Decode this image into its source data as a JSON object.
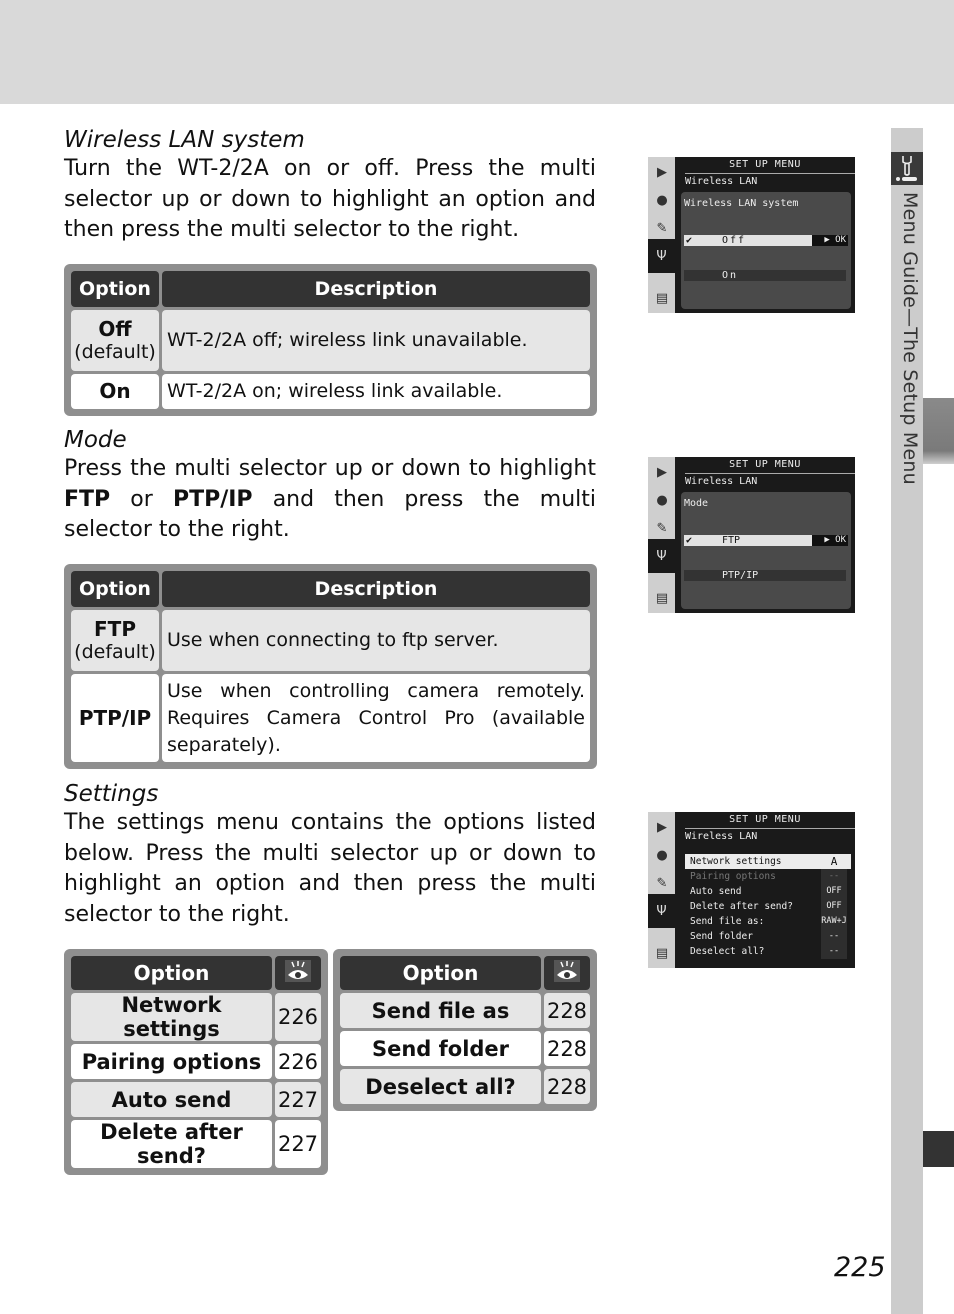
{
  "page": {
    "number": "225",
    "side_label": "Menu Guide—The Setup Menu",
    "side_icon": "wrench-icon"
  },
  "sections": {
    "wireless_lan_system": {
      "title": "Wireless LAN system",
      "body": "Turn the WT-2/2A on or off.  Press the multi selector up or down to highlight an option and then press the multi selector to the right.",
      "table": {
        "headers": [
          "Option",
          "Description"
        ],
        "rows": [
          {
            "option": "Off",
            "sub": "(default)",
            "description": "WT-2/2A off; wireless link unavailable."
          },
          {
            "option": "On",
            "sub": "",
            "description": "WT-2/2A on; wireless link available."
          }
        ]
      }
    },
    "mode": {
      "title": "Mode",
      "body_parts": [
        "Press the multi selector up or down to highlight ",
        "FTP",
        " or ",
        "PTP/IP",
        " and then press the multi selector to the right."
      ],
      "table": {
        "headers": [
          "Option",
          "Description"
        ],
        "rows": [
          {
            "option": "FTP",
            "sub": "(default)",
            "description": "Use when connecting to ftp server."
          },
          {
            "option": "PTP/IP",
            "sub": "",
            "description": "Use when controlling camera remotely. Requires Camera Control Pro (available separately)."
          }
        ]
      }
    },
    "settings": {
      "title": "Settings",
      "body": "The settings menu contains the options listed below.  Press the multi selector up or down to highlight an option and then press the multi selector to the right.",
      "table_left": {
        "headers": [
          "Option",
          "eye-icon"
        ],
        "rows": [
          {
            "option": "Network settings",
            "page": "226"
          },
          {
            "option": "Pairing options",
            "page": "226"
          },
          {
            "option": "Auto send",
            "page": "227"
          },
          {
            "option": "Delete after send?",
            "page": "227"
          }
        ]
      },
      "table_right": {
        "headers": [
          "Option",
          "eye-icon"
        ],
        "rows": [
          {
            "option": "Send file as",
            "page": "228"
          },
          {
            "option": "Send folder",
            "page": "228"
          },
          {
            "option": "Deselect all?",
            "page": "228"
          }
        ]
      }
    }
  },
  "screens": [
    {
      "header": "SET UP MENU",
      "sub": "Wireless LAN",
      "title": "Wireless LAN system",
      "selected": {
        "check": "✔",
        "value": "Off",
        "ok": "▶ OK"
      },
      "other": "On"
    },
    {
      "header": "SET UP MENU",
      "sub": "Wireless LAN",
      "title": "Mode",
      "selected": {
        "check": "✔",
        "value": "FTP",
        "ok": "▶ OK"
      },
      "other": "PTP/IP"
    },
    {
      "header": "SET UP MENU",
      "sub": "Wireless LAN",
      "items": [
        {
          "label": "Network settings",
          "value": "A"
        },
        {
          "label": "Pairing options",
          "value": "--"
        },
        {
          "label": "Auto send",
          "value": "OFF"
        },
        {
          "label": "Delete after send?",
          "value": "OFF"
        },
        {
          "label": "Send file as:",
          "value": "RAW+J"
        },
        {
          "label": "Send folder",
          "value": "--"
        },
        {
          "label": "Deselect all?",
          "value": "--"
        }
      ]
    }
  ],
  "colors": {
    "header_dark": "#333333",
    "row_shade": "#e6e6e6",
    "table_frame": "#8f8f8f",
    "top_band": "#d9d9d9",
    "side_strip": "#cccccc"
  }
}
